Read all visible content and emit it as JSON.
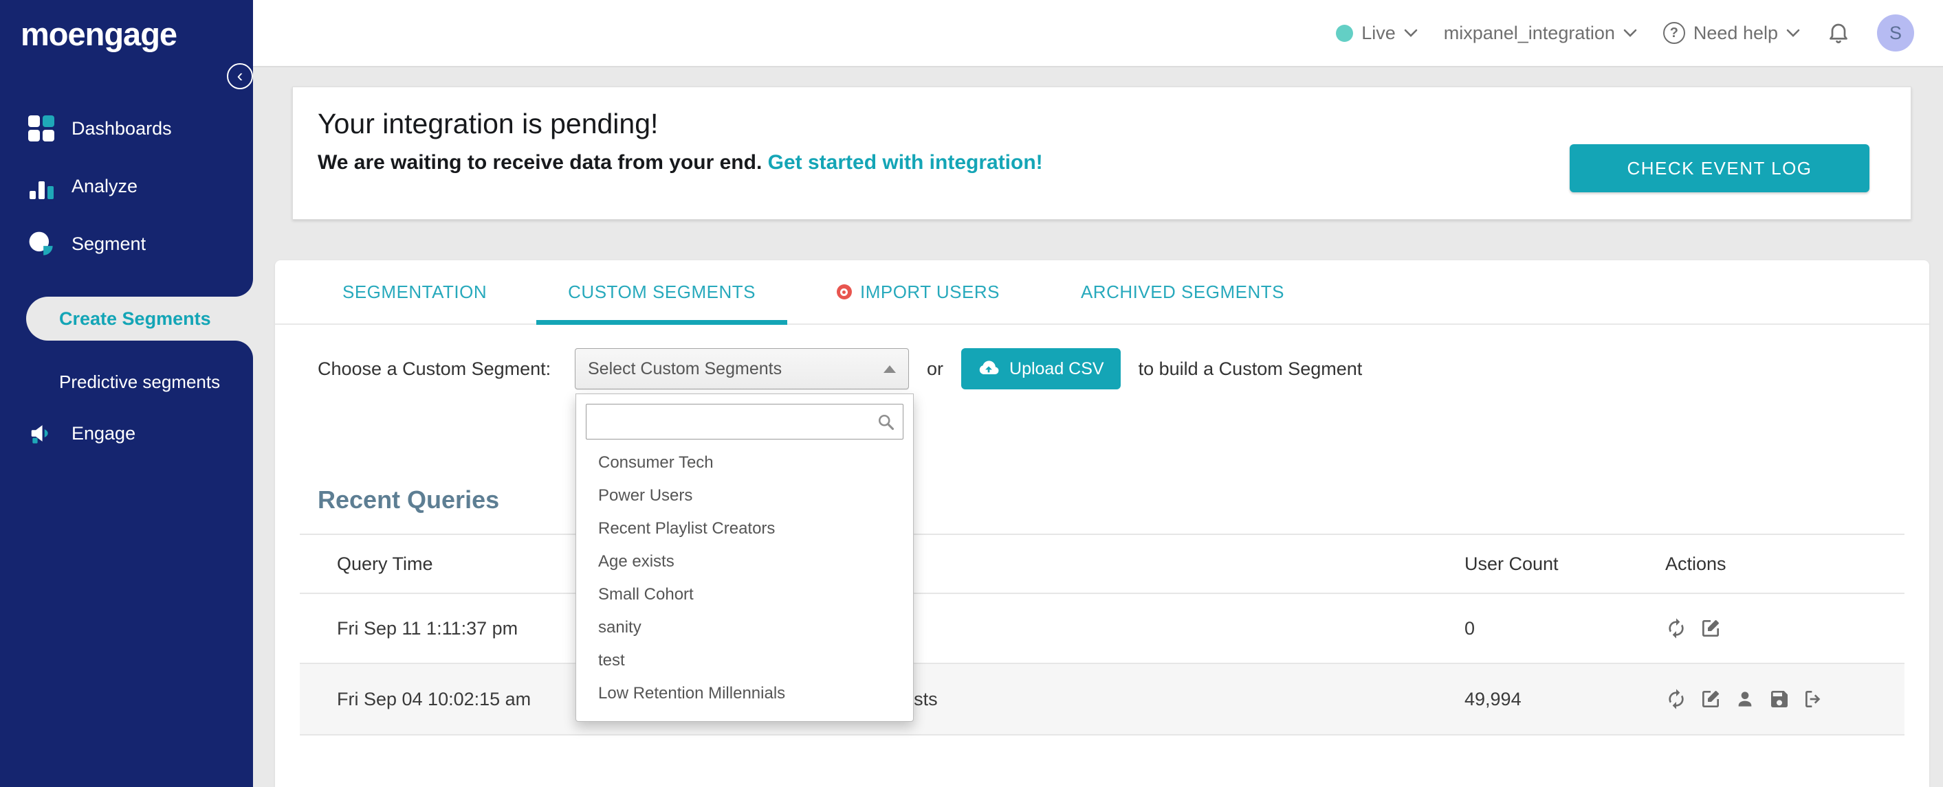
{
  "colors": {
    "sidebar_navy": "#15256f",
    "accent_teal": "#14a5b6",
    "live_dot_teal": "#63cfc5",
    "import_dot_red": "#e8554f",
    "avatar_bg": "#b6bbf2",
    "recent_queries_heading": "#5d7e93",
    "row_shade": "#f6f6f6"
  },
  "sidebar": {
    "logo": "moengage",
    "items": [
      {
        "label": "Dashboards"
      },
      {
        "label": "Analyze"
      },
      {
        "label": "Segment"
      },
      {
        "label": "Create Segments",
        "active": true
      },
      {
        "label": "Predictive segments"
      },
      {
        "label": "Engage"
      }
    ]
  },
  "topbar": {
    "live_label": "Live",
    "project_name": "mixpanel_integration",
    "help_label": "Need help",
    "avatar_initial": "S"
  },
  "banner": {
    "title": "Your integration is pending!",
    "subtitle": "We are waiting to receive data from your end.",
    "link_label": "Get started with integration!",
    "button_label": "CHECK EVENT LOG"
  },
  "tabs": [
    {
      "label": "SEGMENTATION",
      "active": false
    },
    {
      "label": "CUSTOM SEGMENTS",
      "active": true
    },
    {
      "label": "IMPORT USERS",
      "active": false,
      "dot": true
    },
    {
      "label": "ARCHIVED SEGMENTS",
      "active": false
    }
  ],
  "chooser": {
    "label": "Choose a Custom Segment:",
    "select_value": "Select Custom Segments",
    "or_label": "or",
    "upload_label": "Upload CSV",
    "suffix_label": "to build a Custom Segment",
    "search_value": ""
  },
  "dropdown": {
    "options": [
      "Consumer Tech",
      "Power Users",
      "Recent Playlist Creators",
      "Age exists",
      "Small Cohort",
      "sanity",
      "test",
      "Low Retention Millennials"
    ]
  },
  "recent_queries": {
    "title": "Recent Queries",
    "columns": {
      "time": "Query Time",
      "count": "User Count",
      "actions": "Actions"
    },
    "rows": [
      {
        "time": "Fri Sep 11 1:11:37 pm",
        "query": "",
        "count": "0"
      },
      {
        "time": "Fri Sep 04 10:02:15 am",
        "query": "Users in custom segment: Age exists",
        "count": "49,994"
      }
    ]
  }
}
